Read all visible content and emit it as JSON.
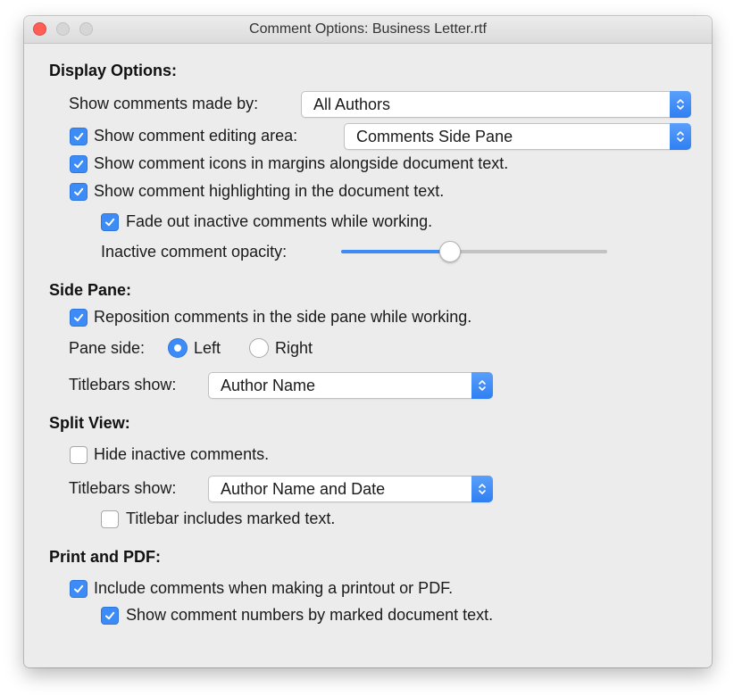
{
  "window": {
    "title": "Comment Options: Business Letter.rtf"
  },
  "display_options": {
    "heading": "Display Options:",
    "show_comments_made_by_label": "Show comments made by:",
    "show_comments_made_by_value": "All Authors",
    "show_editing_area": {
      "label": "Show comment editing area:",
      "checked": true
    },
    "editing_area_value": "Comments Side Pane",
    "show_icons": {
      "label": "Show comment icons in margins alongside document text.",
      "checked": true
    },
    "show_highlighting": {
      "label": "Show comment highlighting in the document text.",
      "checked": true
    },
    "fade_out": {
      "label": "Fade out inactive comments while working.",
      "checked": true
    },
    "opacity_label": "Inactive comment opacity:",
    "opacity_level": 0.41
  },
  "side_pane": {
    "heading": "Side Pane:",
    "reposition": {
      "label": "Reposition comments in the side pane while working.",
      "checked": true
    },
    "pane_side_label": "Pane side:",
    "pane_side_options": [
      "Left",
      "Right"
    ],
    "pane_side_selected": "Left",
    "titlebars_label": "Titlebars show:",
    "titlebars_value": "Author Name"
  },
  "split_view": {
    "heading": "Split View:",
    "hide_inactive": {
      "label": "Hide inactive comments.",
      "checked": false
    },
    "titlebars_label": "Titlebars show:",
    "titlebars_value": "Author Name and Date",
    "titlebar_marked": {
      "label": "Titlebar includes marked text.",
      "checked": false
    }
  },
  "print_pdf": {
    "heading": "Print and PDF:",
    "include_comments": {
      "label": "Include comments when making a printout or PDF.",
      "checked": true
    },
    "show_numbers": {
      "label": "Show comment numbers by marked document text.",
      "checked": true
    }
  },
  "colors": {
    "accent": "#3d8bf7",
    "close_button": "#ff5f57",
    "window_background": "#ececec"
  },
  "icons": {
    "check": "checkmark-icon",
    "popup": "up-down-chevron-icon"
  }
}
